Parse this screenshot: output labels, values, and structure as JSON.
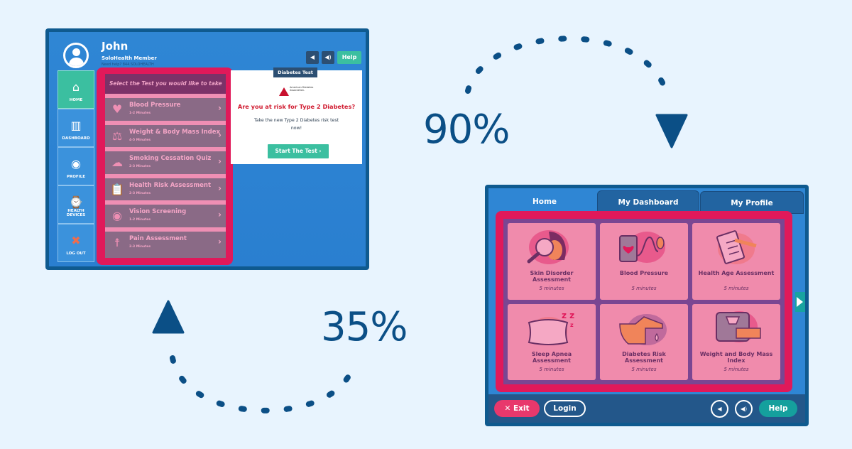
{
  "old_ui": {
    "user_name": "John",
    "member_label": "SoloHealth Member",
    "help_line": "Need help? 844.SOLOHEALTH",
    "header_buttons": {
      "volume_down_icon": "volume-low-icon",
      "volume_up_icon": "volume-high-icon",
      "help_label": "Help"
    },
    "sidebar": [
      {
        "label": "HOME",
        "icon": "home-icon",
        "glyph": "⌂",
        "active": true
      },
      {
        "label": "DASHBOARD",
        "icon": "bar-chart-icon",
        "glyph": "▥",
        "active": false
      },
      {
        "label": "PROFILE",
        "icon": "profile-icon",
        "glyph": "◉",
        "active": false
      },
      {
        "label": "HEALTH DEVICES",
        "icon": "watch-icon",
        "glyph": "⌚",
        "active": false
      },
      {
        "label": "LOG OUT",
        "icon": "close-icon",
        "glyph": "✖",
        "active": false
      }
    ],
    "test_panel": {
      "title": "Select the Test you would like to take",
      "tests": [
        {
          "name": "Blood Pressure",
          "duration": "1-2 Minutes",
          "icon": "heart-pulse-icon",
          "glyph": "♥"
        },
        {
          "name": "Weight & Body Mass Index",
          "duration": "4-5 Minutes",
          "icon": "scale-icon",
          "glyph": "⚖"
        },
        {
          "name": "Smoking Cessation Quiz",
          "duration": "2-3 Minutes",
          "icon": "pipe-icon",
          "glyph": "☁"
        },
        {
          "name": "Health Risk Assessment",
          "duration": "2-3 Minutes",
          "icon": "clipboard-icon",
          "glyph": "📋"
        },
        {
          "name": "Vision Screening",
          "duration": "1-2 Minutes",
          "icon": "eye-icon",
          "glyph": "◉"
        },
        {
          "name": "Pain Assessment",
          "duration": "2-3 Minutes",
          "icon": "body-icon",
          "glyph": "☨"
        }
      ],
      "arrow_glyph": "›"
    },
    "promo": {
      "tab_label": "Diabetes Test",
      "logo_text": "American Diabetes Association.",
      "headline": "Are you at risk for Type 2 Diabetes?",
      "subtext": "Take the new Type 2 Diabetes risk test now!",
      "button_label": "Start The Test ›"
    }
  },
  "transitions": {
    "forward_percent": "90%",
    "backward_percent": "35%"
  },
  "new_ui": {
    "tabs": [
      {
        "label": "Home",
        "active": true
      },
      {
        "label": "My Dashboard",
        "active": false
      },
      {
        "label": "My Profile",
        "active": false
      }
    ],
    "cards": [
      {
        "name": "Skin Disorder Assessment",
        "duration": "5 minutes",
        "icon": "magnifier-face-icon"
      },
      {
        "name": "Blood Pressure",
        "duration": "5 minutes",
        "icon": "blood-pressure-cuff-icon"
      },
      {
        "name": "Health Age Assessment",
        "duration": "5 minutes",
        "icon": "clipboard-pencil-icon"
      },
      {
        "name": "Sleep Apnea Assessment",
        "duration": "5 minutes",
        "icon": "pillow-zzz-icon"
      },
      {
        "name": "Diabetes Risk Assessment",
        "duration": "5 minutes",
        "icon": "finger-drop-icon"
      },
      {
        "name": "Weight and Body Mass Index",
        "duration": "5 minutes",
        "icon": "scale-tape-icon"
      }
    ],
    "footer": {
      "exit_label": "✕ Exit",
      "login_label": "Login",
      "volume_down_glyph": "◀",
      "volume_up_glyph": "◀)",
      "help_label": "Help"
    }
  },
  "colors": {
    "background": "#e8f4fe",
    "frame_navy": "#0f5a8f",
    "screen_blue": "#2f86d4",
    "highlight_pink": "#e0195a",
    "teal": "#3bbfa0",
    "card_pink": "#f08bac",
    "card_purple_text": "#6a2f64",
    "arrow_navy": "#0b4f86"
  }
}
